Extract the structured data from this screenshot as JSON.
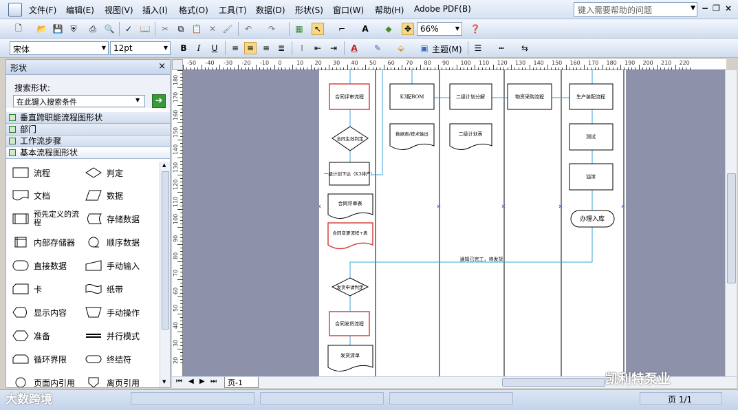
{
  "menu": {
    "items": [
      "文件(F)",
      "编辑(E)",
      "视图(V)",
      "插入(I)",
      "格式(O)",
      "工具(T)",
      "数据(D)",
      "形状(S)",
      "窗口(W)",
      "帮助(H)",
      "Adobe PDF(B)"
    ],
    "help_placeholder": "键入需要帮助的问题"
  },
  "toolbar": {
    "zoom": "66%",
    "font_name": "宋体",
    "font_size": "12pt",
    "theme_label": "主题(M)",
    "bold": "B",
    "italic": "I",
    "underline": "U",
    "text_tool": "A"
  },
  "shapes_panel": {
    "title": "形状",
    "search_label": "搜索形状:",
    "search_placeholder": "在此键入搜索条件",
    "stencils": [
      "垂直跨职能流程图形状",
      "部门",
      "工作流步骤",
      "基本流程图形状"
    ],
    "shapes": [
      [
        "流程",
        "判定"
      ],
      [
        "文档",
        "数据"
      ],
      [
        "预先定义的流程",
        "存储数据"
      ],
      [
        "内部存储器",
        "顺序数据"
      ],
      [
        "直接数据",
        "手动输入"
      ],
      [
        "卡",
        "纸带"
      ],
      [
        "显示内容",
        "手动操作"
      ],
      [
        "准备",
        "并行模式"
      ],
      [
        "循环界限",
        "终结符"
      ],
      [
        "页面内引用",
        "离页引用"
      ]
    ]
  },
  "ruler": {
    "h_ticks": [
      "-50",
      "-40",
      "-30",
      "-20",
      "-10",
      "0",
      "10",
      "20",
      "30",
      "40",
      "50",
      "60",
      "70",
      "80",
      "90",
      "100",
      "110",
      "120",
      "130",
      "140",
      "150",
      "160",
      "170",
      "180",
      "190",
      "200",
      "210",
      "220"
    ],
    "v_ticks": [
      "180",
      "170",
      "160",
      "150",
      "140",
      "130",
      "120",
      "110",
      "100",
      "90",
      "80",
      "70",
      "60",
      "50",
      "40",
      "30",
      "20"
    ]
  },
  "diagram": {
    "col1": {
      "review": "合同评审流程",
      "decision": "合同生效判定",
      "plan1": "一级计划下达（K3排产）",
      "review_form": "合同评审表",
      "change_flow": "合同变更流程+表",
      "ship_decision": "发货申请判定",
      "ship_flow": "合同发货流程",
      "ship_list": "发货清单"
    },
    "col2": {
      "bom": "K3配BOM",
      "doc": "数据表/技术输出"
    },
    "col3": {
      "split": "二级计划分解",
      "doc": "二级计划表"
    },
    "col4": {
      "purchase": "物资采购流程"
    },
    "col5": {
      "assembly": "生产装配流程",
      "test": "测试",
      "paint": "油漆",
      "warehouse": "办理入库"
    },
    "notice": "通知已完工，待发货"
  },
  "page_tab": "页-1",
  "status": {
    "page": "页 1/1"
  },
  "watermarks": {
    "left": "大数跨境",
    "right": "凯利特泵业"
  }
}
